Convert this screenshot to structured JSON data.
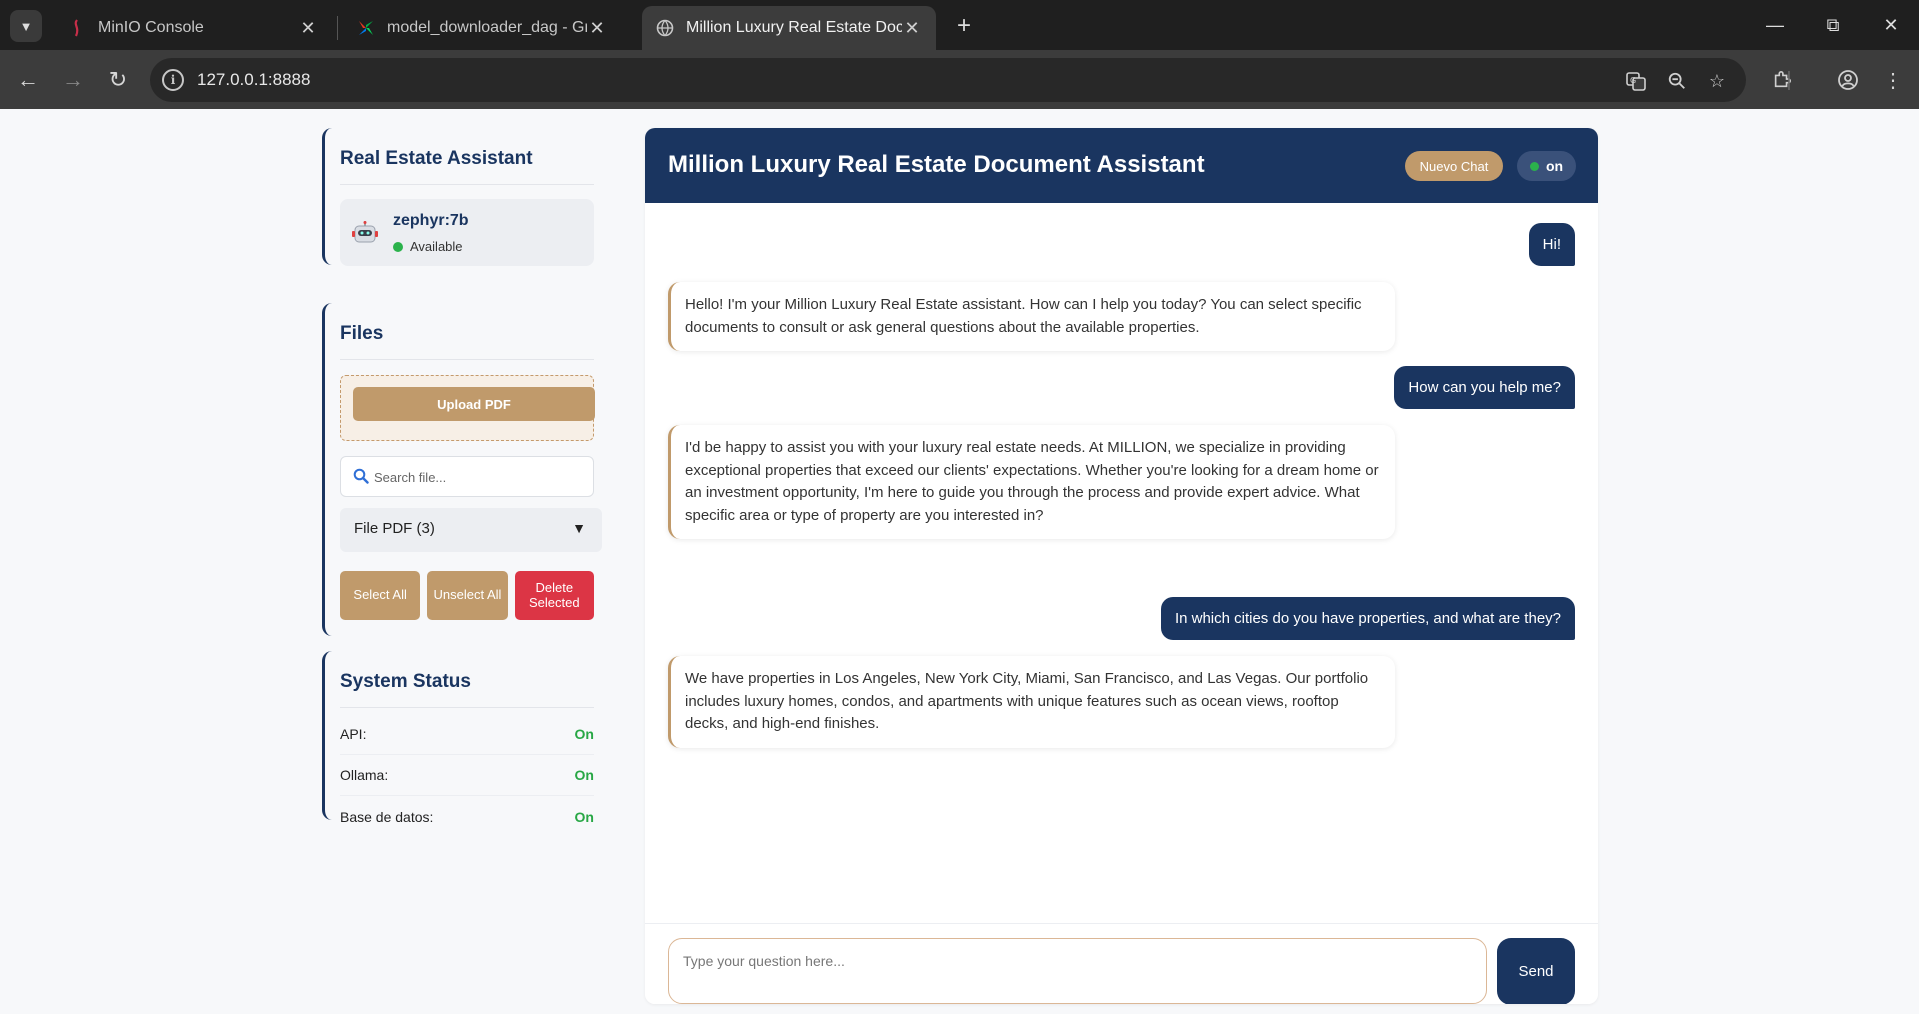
{
  "browser": {
    "tabs": [
      {
        "title": "MinIO Console",
        "favicon": "minio-icon"
      },
      {
        "title": "model_downloader_dag - Graph",
        "favicon": "airflow-icon"
      },
      {
        "title": "Million Luxury Real Estate Document Assistant",
        "favicon": "globe-icon"
      }
    ],
    "url": "127.0.0.1:8888"
  },
  "sidebar": {
    "assistant_title": "Real Estate Assistant",
    "model_name": "zephyr:7b",
    "model_status": "Available",
    "files_title": "Files",
    "upload_label": "Upload PDF",
    "search_placeholder": "Search file...",
    "file_select_label": "File PDF (3)",
    "select_all_label": "Select All",
    "unselect_all_label": "Unselect All",
    "delete_selected_label": "Delete Selected",
    "system_status_title": "System Status",
    "status_items": [
      {
        "label": "API:",
        "value": "On"
      },
      {
        "label": "Ollama:",
        "value": "On"
      },
      {
        "label": "Base de datos:",
        "value": "On"
      }
    ]
  },
  "chat": {
    "title": "Million Luxury Real Estate Document Assistant",
    "new_chat_label": "Nuevo Chat",
    "status_label": "on",
    "messages": [
      {
        "role": "user",
        "text": "Hi!"
      },
      {
        "role": "assistant",
        "text": "Hello! I'm your Million Luxury Real Estate assistant. How can I help you today? You can select specific documents to consult or ask general questions about the available properties."
      },
      {
        "role": "user",
        "text": "How can you help me?"
      },
      {
        "role": "assistant",
        "text": "I'd be happy to assist you with your luxury real estate needs. At MILLION, we specialize in providing exceptional properties that exceed our clients' expectations. Whether you're looking for a dream home or an investment opportunity, I'm here to guide you through the process and provide expert advice. What specific area or type of property are you interested in?"
      },
      {
        "role": "user",
        "text": "In which cities do you have properties, and what are they?"
      },
      {
        "role": "assistant",
        "text": "We have properties in Los Angeles, New York City, Miami, San Francisco, and Las Vegas. Our portfolio includes luxury homes, condos, and apartments with unique features such as ocean views, rooftop decks, and high-end finishes."
      }
    ],
    "input_placeholder": "Type your question here...",
    "send_label": "Send"
  },
  "colors": {
    "navy": "#1a3560",
    "tan": "#c09a6b",
    "danger": "#dc3545",
    "success": "#2bb24c"
  }
}
